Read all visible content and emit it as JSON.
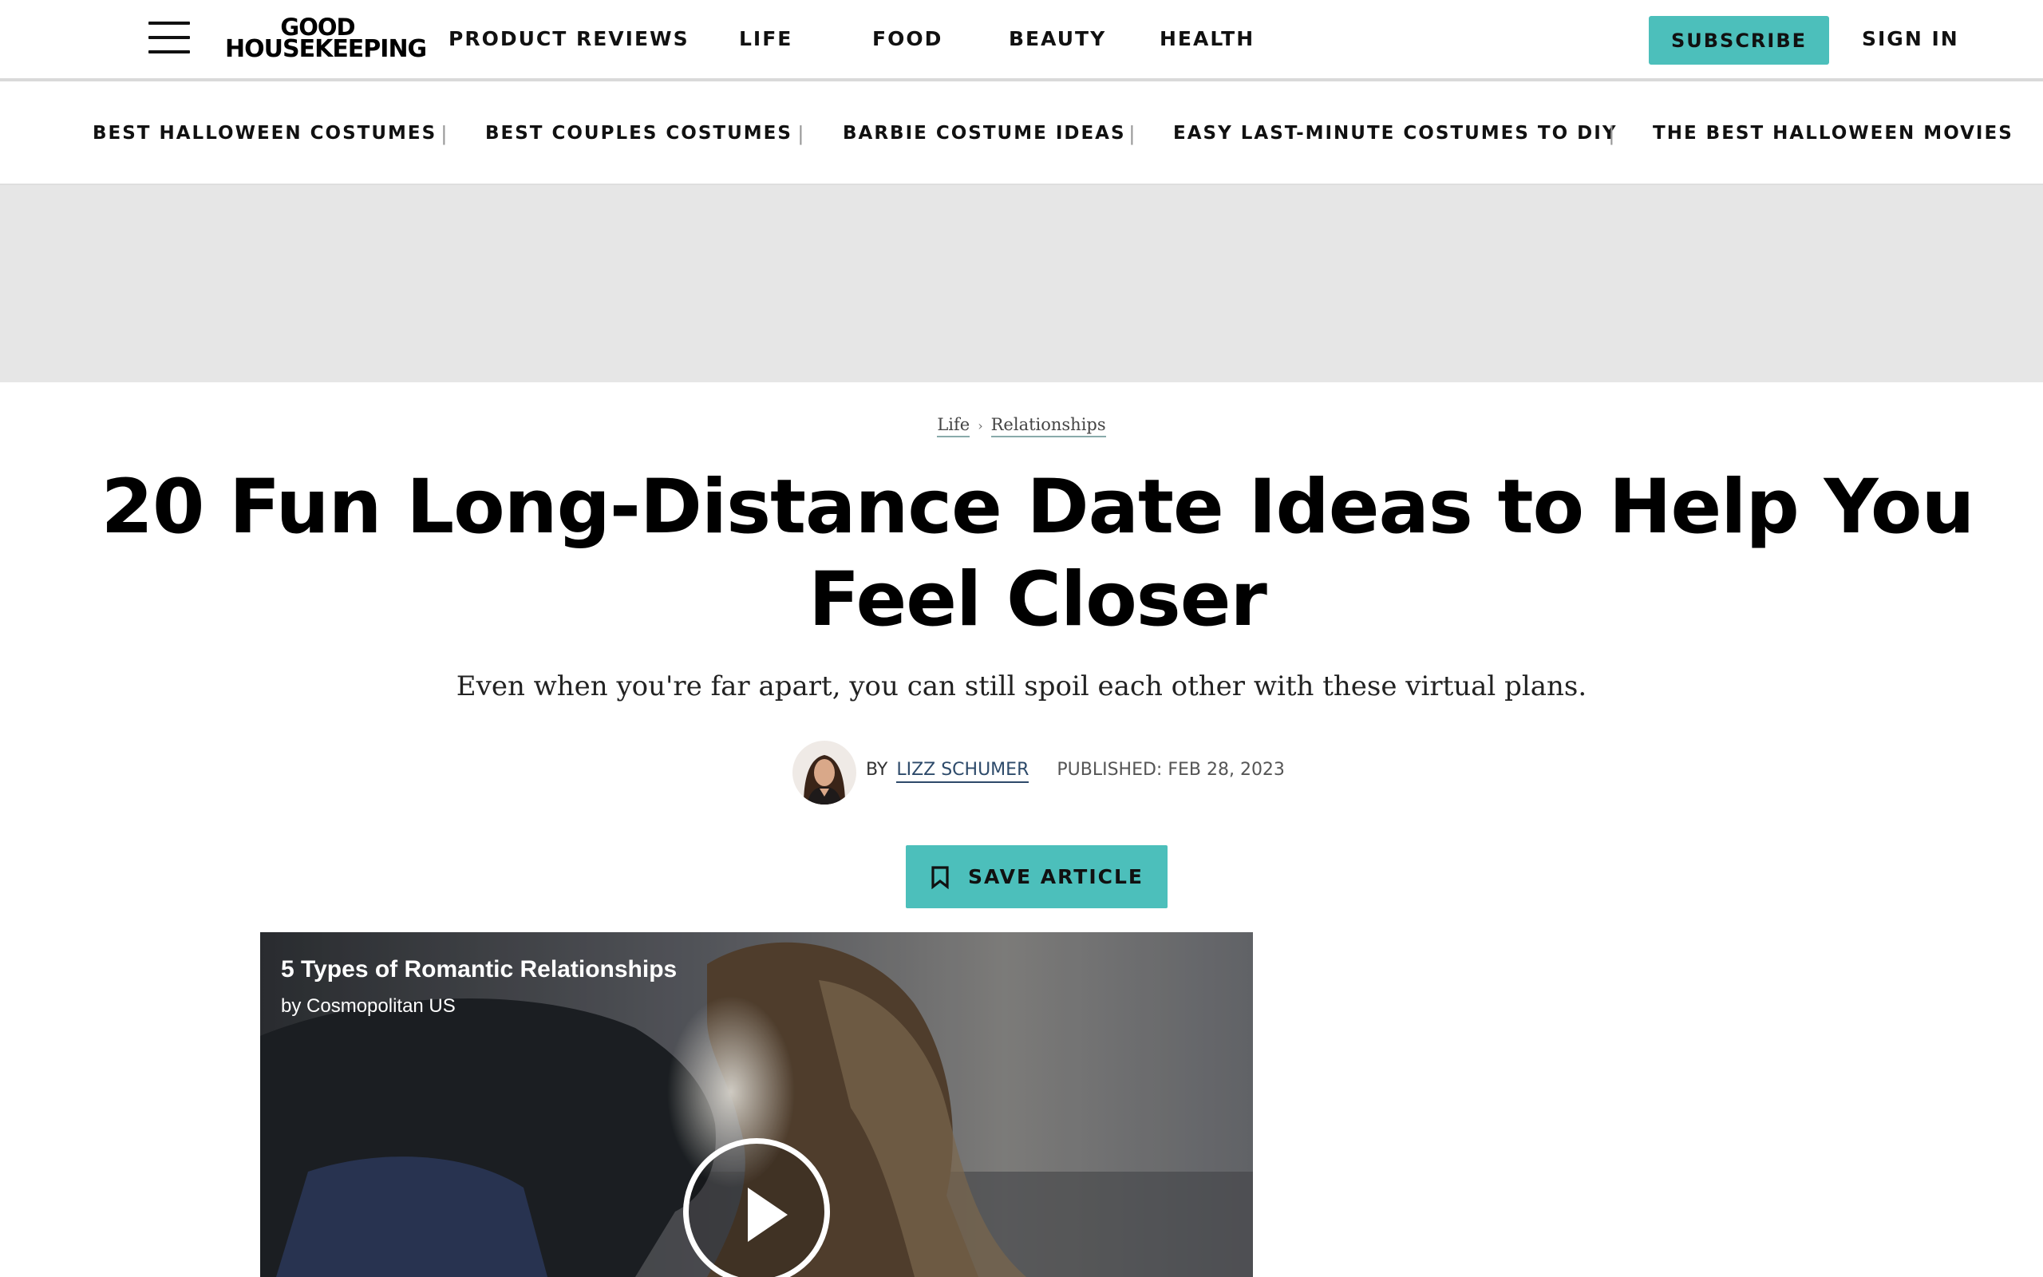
{
  "header": {
    "logo": {
      "line1": "GOOD",
      "line2": "HOUSEKEEPING"
    },
    "nav": [
      {
        "label": "PRODUCT REVIEWS"
      },
      {
        "label": "LIFE"
      },
      {
        "label": "FOOD"
      },
      {
        "label": "BEAUTY"
      },
      {
        "label": "HEALTH"
      }
    ],
    "subscribe_label": "SUBSCRIBE",
    "signin_label": "SIGN IN"
  },
  "subnav": {
    "items": [
      {
        "label": "BEST HALLOWEEN COSTUMES"
      },
      {
        "label": "BEST COUPLES COSTUMES"
      },
      {
        "label": "BARBIE COSTUME IDEAS"
      },
      {
        "label": "EASY LAST-MINUTE COSTUMES TO DIY"
      },
      {
        "label": "THE BEST HALLOWEEN MOVIES"
      }
    ],
    "separator": "|"
  },
  "breadcrumb": {
    "items": [
      {
        "label": "Life"
      },
      {
        "label": "Relationships"
      }
    ],
    "separator": "›"
  },
  "article": {
    "title": "20 Fun Long-Distance Date Ideas to Help You Feel Closer",
    "dek": "Even when you're far apart, you can still spoil each other with these virtual plans.",
    "byline_prefix": "BY",
    "author": "LIZZ SCHUMER",
    "published": "PUBLISHED: FEB 28, 2023",
    "save_label": "SAVE ARTICLE"
  },
  "video": {
    "title": "5 Types of Romantic Relationships",
    "source": "by Cosmopolitan US"
  },
  "colors": {
    "accent": "#4cbfbb",
    "ad_background": "#e6e6e6",
    "text": "#000000"
  },
  "icons": {
    "menu": "hamburger-menu-icon",
    "save": "bookmark-icon",
    "play": "play-icon"
  }
}
